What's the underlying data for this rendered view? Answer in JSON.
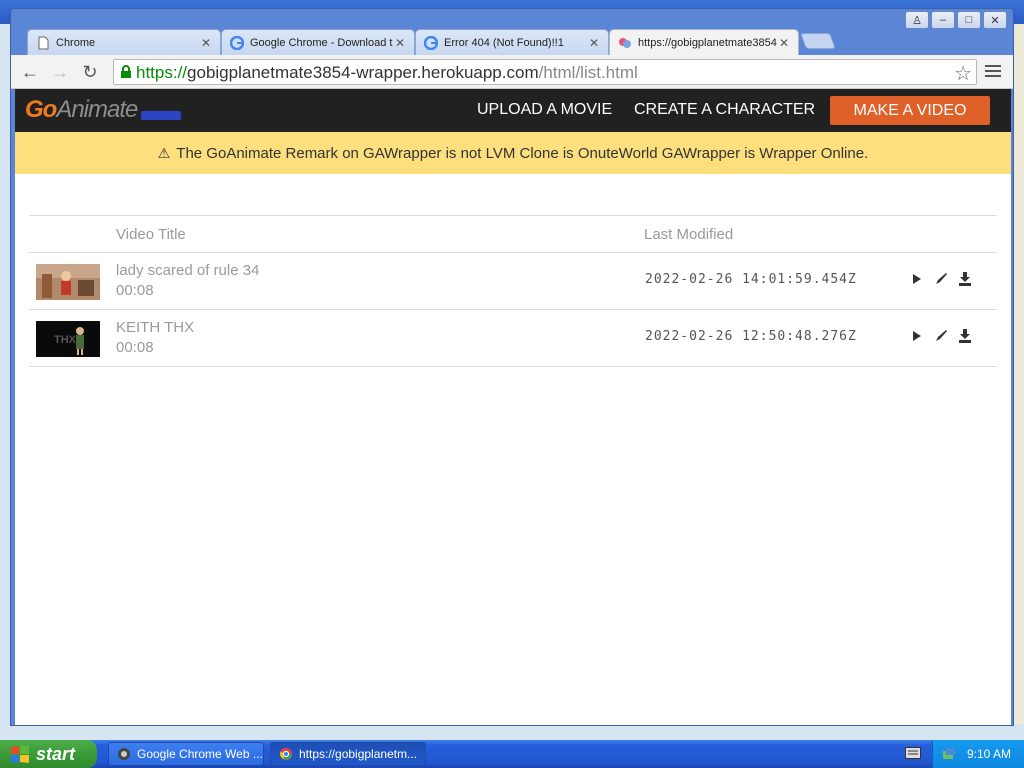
{
  "browser": {
    "tabs": [
      {
        "label": "Chrome",
        "icon": "page-icon"
      },
      {
        "label": "Google Chrome - Download t",
        "icon": "google-g-icon"
      },
      {
        "label": "Error 404 (Not Found)!!1",
        "icon": "google-g-icon"
      },
      {
        "label": "https://gobigplanetmate3854",
        "icon": "site-icon"
      }
    ],
    "url": {
      "scheme": "https://",
      "host": "gobigplanetmate3854-wrapper.herokuapp.com",
      "path": "/html/list.html"
    }
  },
  "site": {
    "logo_go": "Go",
    "logo_animate": "Animate",
    "nav": {
      "upload": "UPLOAD A MOVIE",
      "create": "CREATE A CHARACTER",
      "make": "MAKE A VIDEO"
    },
    "notice": "The GoAnimate Remark on GAWrapper is not LVM Clone is OnuteWorld GAWrapper is Wrapper Online.",
    "table": {
      "headers": {
        "title": "Video Title",
        "modified": "Last Modified"
      },
      "rows": [
        {
          "title": "lady scared of rule 34",
          "duration": "00:08",
          "modified": "2022-02-26  14:01:59.454Z"
        },
        {
          "title": "KEITH THX",
          "duration": "00:08",
          "modified": "2022-02-26  12:50:48.276Z"
        }
      ]
    }
  },
  "taskbar": {
    "start": "start",
    "tasks": [
      {
        "label": "Google Chrome Web ..."
      },
      {
        "label": "https://gobigplanetm..."
      }
    ],
    "clock": "9:10 AM"
  },
  "colors": {
    "accent": "#e0602a",
    "notice_bg": "#fddf7e",
    "header_bg": "#212121"
  }
}
